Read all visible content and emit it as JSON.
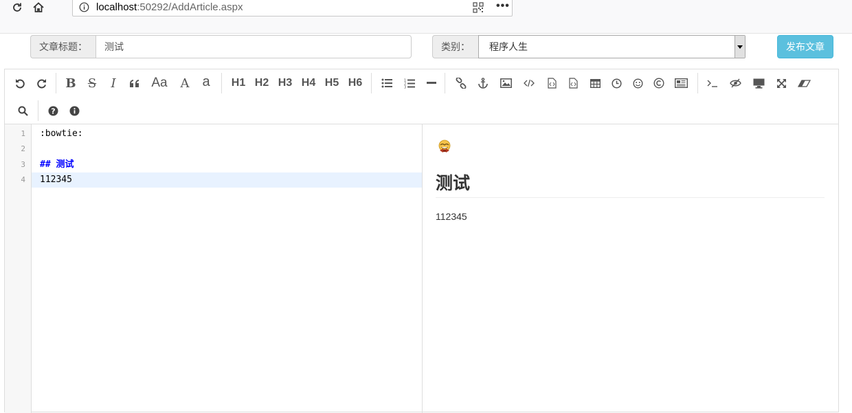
{
  "browser": {
    "url_host": "localhost",
    "url_rest": ":50292/AddArticle.aspx",
    "reload_icon": "reload-icon",
    "home_icon": "home-icon",
    "info_icon": "info-icon",
    "qr_icon": "qr-code-icon",
    "more_label": "•••"
  },
  "form": {
    "title_label": "文章标题：",
    "title_value": "测试",
    "category_label": "类别：",
    "category_value": "程序人生",
    "publish_label": "发布文章",
    "publish_color": "#5bc0de"
  },
  "toolbar": {
    "headings": [
      "H1",
      "H2",
      "H3",
      "H4",
      "H5",
      "H6"
    ],
    "font_size_label": "Aa",
    "uppercase_label": "A",
    "lowercase_label": "a"
  },
  "editor": {
    "line_numbers": [
      "1",
      "2",
      "3",
      "4"
    ],
    "lines": [
      ":bowtie:",
      "",
      "## ",
      "112345"
    ],
    "line3_heading": "测试"
  },
  "preview": {
    "emoji_icon": "bowtie-emoji-icon",
    "heading": "测试",
    "paragraph": "112345"
  }
}
